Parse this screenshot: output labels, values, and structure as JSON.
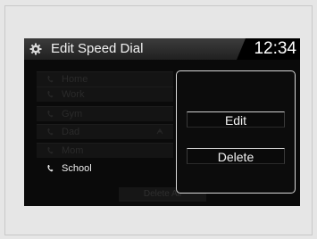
{
  "header": {
    "icon": "gear-icon",
    "title": "Edit Speed Dial",
    "clock": "12:34"
  },
  "speed_dial": {
    "entries": [
      {
        "label": "Home",
        "icon": "phone-icon"
      },
      {
        "label": "Work",
        "icon": "phone-icon"
      },
      {
        "label": "Gym",
        "icon": "phone-icon"
      },
      {
        "label": "Dad",
        "icon": "phone-icon",
        "voice_tag": "voice-tag-icon"
      },
      {
        "label": "Mom",
        "icon": "phone-icon"
      },
      {
        "label": "School",
        "icon": "phone-icon"
      }
    ],
    "selected": "School",
    "delete_all_label": "Delete All"
  },
  "popup": {
    "edit_label": "Edit",
    "delete_label": "Delete"
  },
  "colors": {
    "screen_bg": "#0a0a0a",
    "titlebar_bg": "#2c2c2c",
    "popup_border": "#d9d9d9",
    "text_active": "#f0f0f0",
    "text_dim": "#2a2a2a"
  }
}
